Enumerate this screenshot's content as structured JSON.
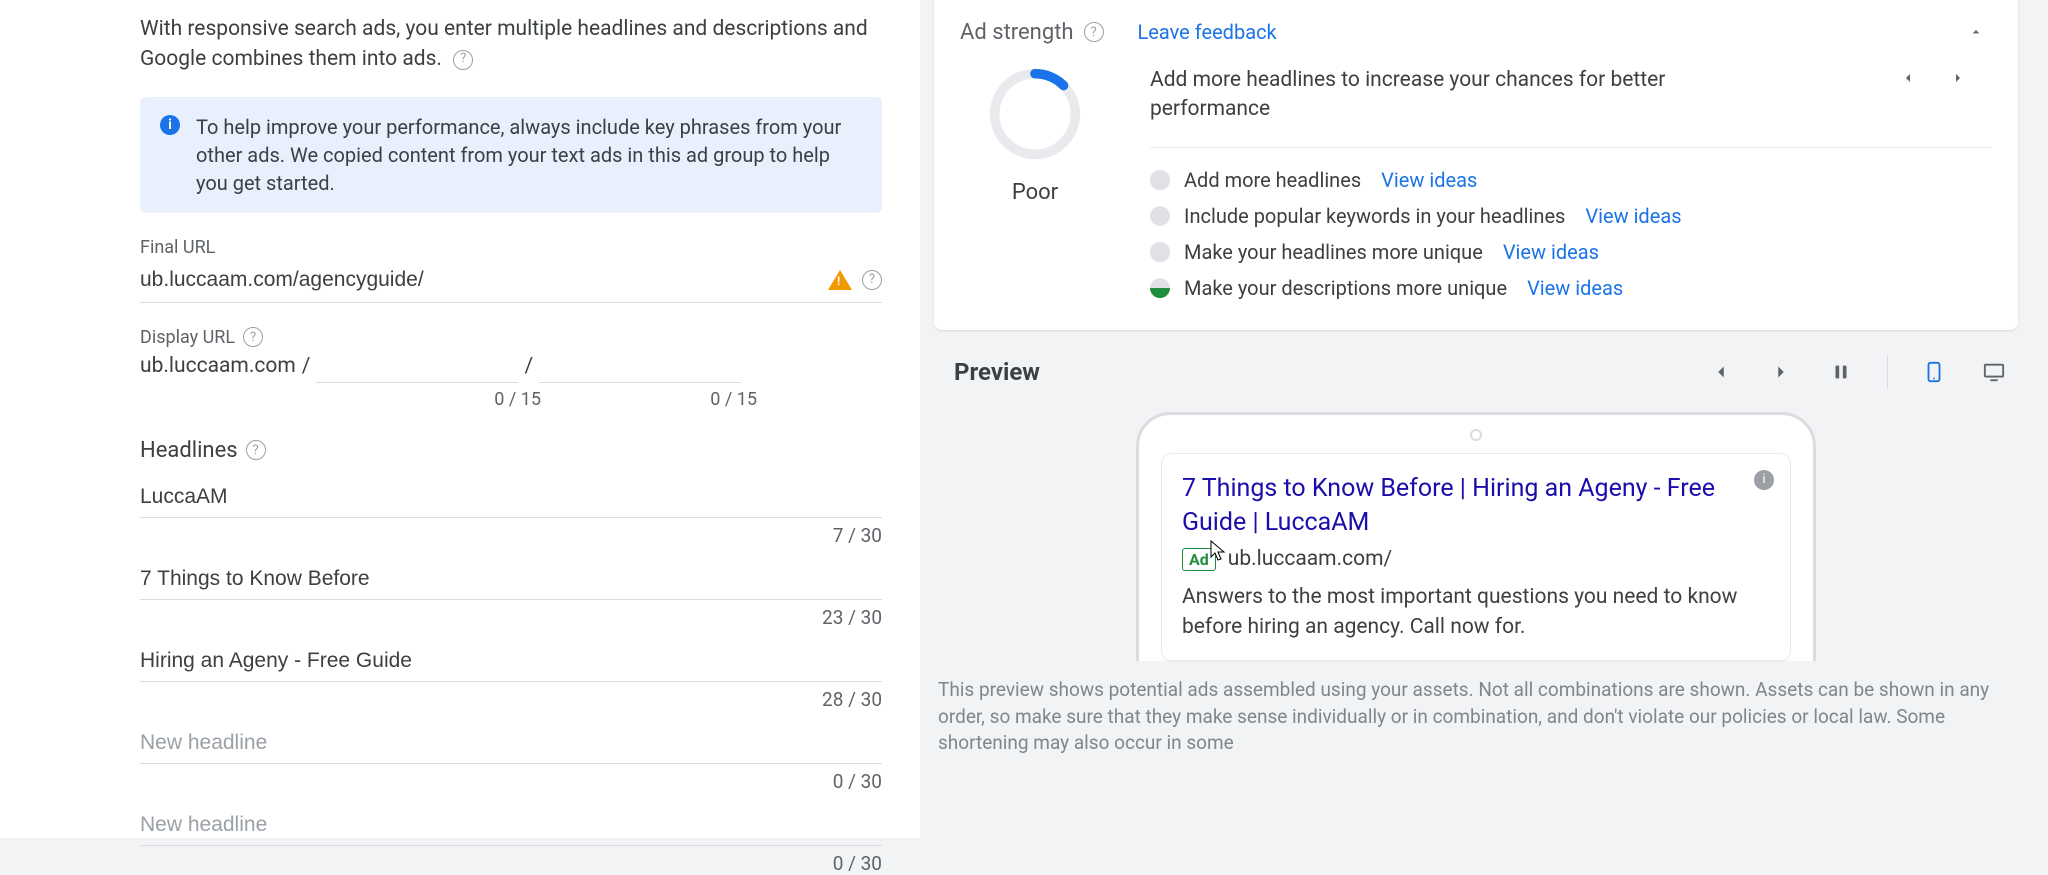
{
  "intro": "With responsive search ads, you enter multiple headlines and descriptions and Google combines them into ads.",
  "info_box": "To help improve your performance, always include key phrases from your other ads. We copied content from your text ads in this ad group to help you get started.",
  "final_url": {
    "label": "Final URL",
    "value": "ub.luccaam.com/agencyguide/"
  },
  "display_url": {
    "label": "Display URL",
    "domain": "ub.luccaam.com",
    "path1": "",
    "path2": "",
    "counter1": "0 / 15",
    "counter2": "0 / 15"
  },
  "headlines": {
    "label": "Headlines",
    "items": [
      {
        "value": "LuccaAM",
        "placeholder": "New headline",
        "counter": "7 / 30"
      },
      {
        "value": "7 Things to Know Before",
        "placeholder": "New headline",
        "counter": "23 / 30"
      },
      {
        "value": "Hiring an Ageny - Free Guide",
        "placeholder": "New headline",
        "counter": "28 / 30"
      },
      {
        "value": "",
        "placeholder": "New headline",
        "counter": "0 / 30"
      },
      {
        "value": "",
        "placeholder": "New headline",
        "counter": "0 / 30"
      }
    ]
  },
  "ad_strength": {
    "title": "Ad strength",
    "feedback_link": "Leave feedback",
    "grade": "Poor",
    "headline": "Add more headlines to increase your chances for better performance",
    "tips": [
      {
        "text": "Add more headlines",
        "link": "View ideas",
        "dot": "grey"
      },
      {
        "text": "Include popular keywords in your headlines",
        "link": "View ideas",
        "dot": "grey"
      },
      {
        "text": "Make your headlines more unique",
        "link": "View ideas",
        "dot": "grey"
      },
      {
        "text": "Make your descriptions more unique",
        "link": "View ideas",
        "dot": "half"
      }
    ]
  },
  "preview": {
    "title": "Preview",
    "ad": {
      "title": "7 Things to Know Before | Hiring an Ageny - Free Guide | LuccaAM",
      "badge": "Ad",
      "url": "ub.luccaam.com/",
      "description": "Answers to the most important questions you need to know before hiring an agency. Call now for."
    },
    "note": "This preview shows potential ads assembled using your assets. Not all combinations are shown. Assets can be shown in any order, so make sure that they make sense individually or in combination, and don't violate our policies or local law. Some shortening may also occur in some"
  }
}
